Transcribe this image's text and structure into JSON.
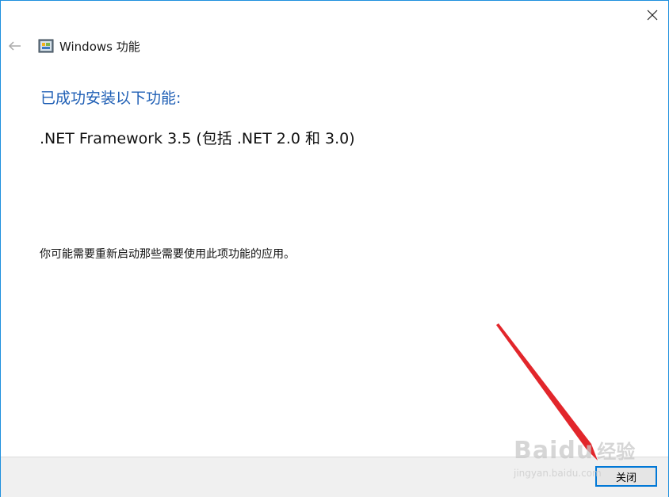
{
  "window": {
    "title": "Windows 功能",
    "close_glyph": "✕",
    "back_glyph": "←",
    "accent_color": "#1e8fde"
  },
  "content": {
    "heading": "已成功安装以下功能:",
    "feature": ".NET Framework 3.5 (包括 .NET 2.0 和 3.0)",
    "note": "你可能需要重新启动那些需要使用此项功能的应用。"
  },
  "footer": {
    "close_label": "关闭"
  },
  "watermark": {
    "brand": "Baidu",
    "cn": "经验",
    "url": "jingyan.baidu.com"
  }
}
